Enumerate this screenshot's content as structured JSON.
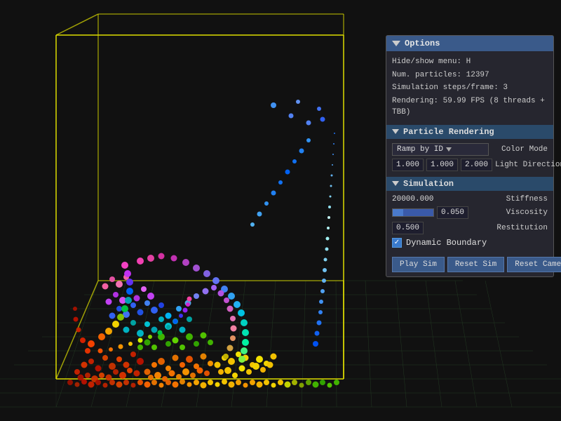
{
  "panel": {
    "title": "Options",
    "info": {
      "hotkey_line": "Hide/show menu: H",
      "particles_line": "Num. particles: 12397",
      "sim_steps_line": "Simulation steps/frame: 3",
      "rendering_line": "Rendering: 59.99 FPS (8 threads + TBB)"
    },
    "particle_rendering": {
      "title": "Particle Rendering",
      "color_mode_label": "Color Mode",
      "ramp_by_id": "Ramp by ID",
      "val1": "1.000",
      "val2": "1.000",
      "val3": "2.000",
      "light_direction_label": "Light Direction"
    },
    "simulation": {
      "title": "Simulation",
      "stiffness_value": "20000.000",
      "stiffness_label": "Stiffness",
      "viscosity_value": "0.050",
      "viscosity_label": "Viscosity",
      "restitution_value": "0.500",
      "restitution_label": "Restitution",
      "dynamic_boundary_label": "Dynamic Boundary"
    },
    "buttons": {
      "play_sim": "Play Sim",
      "reset_sim": "Reset Sim",
      "reset_camera": "Reset Camera"
    }
  }
}
